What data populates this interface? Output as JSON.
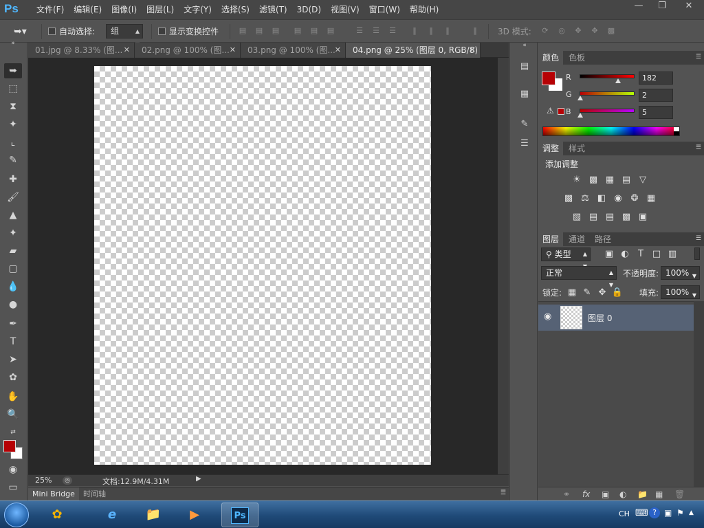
{
  "app": {
    "logo": "Ps"
  },
  "menu": [
    "文件(F)",
    "编辑(E)",
    "图像(I)",
    "图层(L)",
    "文字(Y)",
    "选择(S)",
    "滤镜(T)",
    "3D(D)",
    "视图(V)",
    "窗口(W)",
    "帮助(H)"
  ],
  "options": {
    "auto_select_label": "自动选择:",
    "auto_select_value": "组",
    "show_transform_label": "显示变换控件",
    "mode3d_label": "3D 模式:"
  },
  "tabs": [
    {
      "label": "01.jpg @ 8.33% (图..."
    },
    {
      "label": "02.png @ 100% (图..."
    },
    {
      "label": "03.png @ 100% (图..."
    },
    {
      "label": "04.png @ 25% (图层 0, RGB/8)"
    }
  ],
  "status": {
    "zoom": "25%",
    "doc_info": "文档:12.9M/4.31M"
  },
  "bottom_tabs": [
    "Mini Bridge",
    "时间轴"
  ],
  "color_panel": {
    "tabs": [
      "颜色",
      "色板"
    ],
    "fg_color": "#b60205",
    "channels": [
      {
        "label": "R",
        "value": "182"
      },
      {
        "label": "G",
        "value": "2"
      },
      {
        "label": "B",
        "value": "5"
      }
    ]
  },
  "adjust_panel": {
    "tabs": [
      "调整",
      "样式"
    ],
    "title": "添加调整"
  },
  "layers_panel": {
    "tabs": [
      "图层",
      "通道",
      "路径"
    ],
    "filter_value": "类型",
    "blend_mode": "正常",
    "opacity_label": "不透明度:",
    "opacity_value": "100%",
    "lock_label": "锁定:",
    "fill_label": "填充:",
    "fill_value": "100%",
    "layers": [
      {
        "name": "图层 0"
      }
    ]
  },
  "taskbar": {
    "ime": "CH"
  }
}
